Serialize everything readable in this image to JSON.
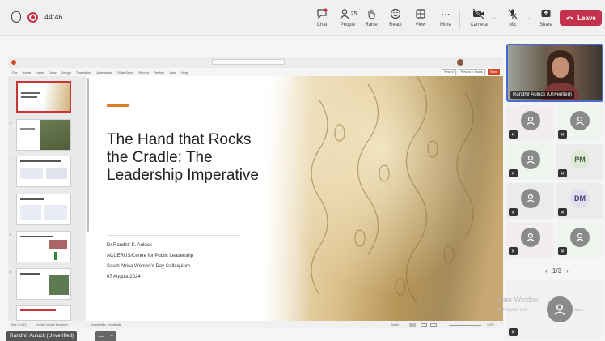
{
  "meeting": {
    "timer": "44:46",
    "people_count": "25",
    "buttons": {
      "chat": "Chat",
      "people": "People",
      "raise": "Raise",
      "react": "React",
      "view": "View",
      "more": "More",
      "camera": "Camera",
      "mic": "Mic",
      "share": "Share",
      "leave": "Leave"
    },
    "colors": {
      "leave": "#c4314b",
      "accent": "#e07b26",
      "active_border": "#4a6cd0"
    }
  },
  "powerpoint": {
    "menu": [
      "File",
      "Home",
      "Insert",
      "Draw",
      "Design",
      "Transitions",
      "Animations",
      "Slide Show",
      "Record",
      "Review",
      "View",
      "Help"
    ],
    "toolbar_right": [
      "Record",
      "Present in Teams",
      "Share"
    ],
    "status_left": "Slide 1 of 15",
    "status_language": "English (United Kingdom)",
    "status_accessibility": "Accessibility: Investigate",
    "status_notes": "Notes",
    "zoom": "122%",
    "thumbnail_numbers": [
      "1",
      "2",
      "3",
      "4",
      "5",
      "6",
      "7"
    ]
  },
  "slide": {
    "title": "The Hand that Rocks the Cradle: The Leadership Imperative",
    "author": "Dr Randhir K. Auluck",
    "organization": "ACCERUS/Centre for Public Leadership",
    "event": "South Africa Women’s Day Colloquium",
    "date": "07 August 2024"
  },
  "participants": {
    "active_speaker": "Randhir Auluck (Unverified)",
    "tile_initials": [
      "PM",
      "DM"
    ],
    "pager": "1/3",
    "bottom_chip": "Randhir Auluck (Unverified)"
  },
  "watermark": {
    "line1": "ivate Windov",
    "line2": "settings to act",
    "line3": "ows."
  }
}
